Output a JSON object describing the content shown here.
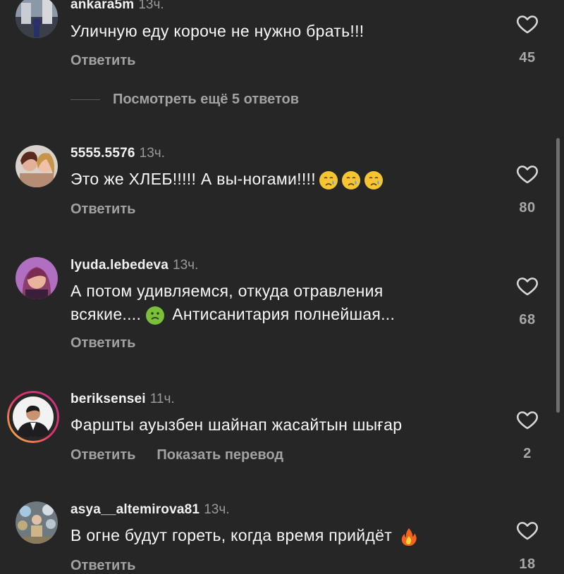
{
  "colors": {
    "background": "#262626",
    "muted": "#a2a2a2",
    "text": "#f7f7f7",
    "story_ring": "#e1306c"
  },
  "comments": [
    {
      "username": "ankara5m",
      "time": "13ч.",
      "text": "Уличную еду короче не нужно брать!!!",
      "reply_label": "Ответить",
      "likes": "45",
      "avatar_icon": "street-photo-avatar"
    },
    {
      "username": "5555.5576",
      "time": "13ч.",
      "text": "Это же ХЛЕБ!!!!! А вы-ногами!!!!",
      "reply_label": "Ответить",
      "likes": "80",
      "avatar_icon": "two-women-avatar"
    },
    {
      "username": "lyuda.lebedeva",
      "time": "13ч.",
      "text_line1": "А потом удивляемся, откуда отравления",
      "text_line2_a": "всякие....",
      "text_line2_b": "Антисанитария полнейшая...",
      "reply_label": "Ответить",
      "likes": "68",
      "avatar_icon": "woman-avatar"
    },
    {
      "username": "beriksensei",
      "time": "11ч.",
      "text": "Фаршты ауызбен шайнап жасайтын шығар",
      "reply_label": "Ответить",
      "translate_label": "Показать перевод",
      "likes": "2",
      "avatar_icon": "man-in-suit-avatar"
    },
    {
      "username": "asya__altemirova81",
      "time": "13ч.",
      "text": "В огне будут гореть, когда время прийдёт",
      "reply_label": "Ответить",
      "likes": "18",
      "avatar_icon": "balloons-avatar"
    }
  ],
  "more_replies": "Посмотреть ещё 5 ответов"
}
